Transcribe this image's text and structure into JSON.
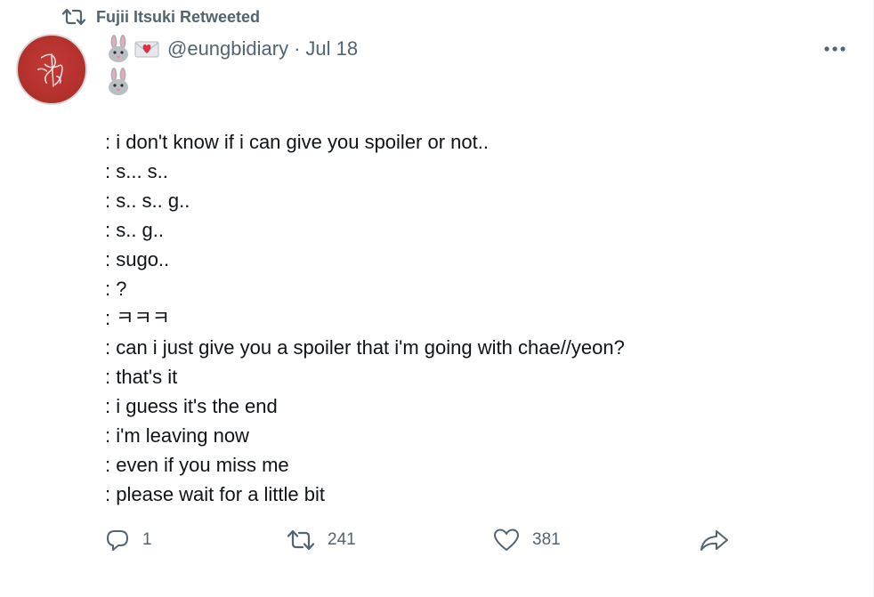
{
  "retweet_header": {
    "label": "Fujii Itsuki Retweeted"
  },
  "tweet": {
    "handle": "@eungbidiary",
    "separator": "·",
    "date": "Jul 18",
    "lines": [
      ": i don't know if i can give you spoiler or not..",
      ": s... s..",
      ": s.. s.. g..",
      ": s.. g..",
      ": sugo..",
      ": ?",
      ": ㅋㅋㅋ",
      ": can i just give you a spoiler that i'm going with chae//yeon?",
      ": that's it",
      ": i guess it's the end",
      ": i'm leaving now",
      ": even if you miss me",
      ": please wait for a little bit"
    ],
    "display_name_emojis": [
      "rabbit-emoji",
      "love-letter-emoji",
      "rabbit-emoji"
    ]
  },
  "actions": {
    "reply_count": "1",
    "retweet_count": "241",
    "like_count": "381"
  },
  "colors": {
    "secondary_text": "#536471",
    "primary_text": "#0f1419",
    "avatar_red": "#b1302c"
  }
}
